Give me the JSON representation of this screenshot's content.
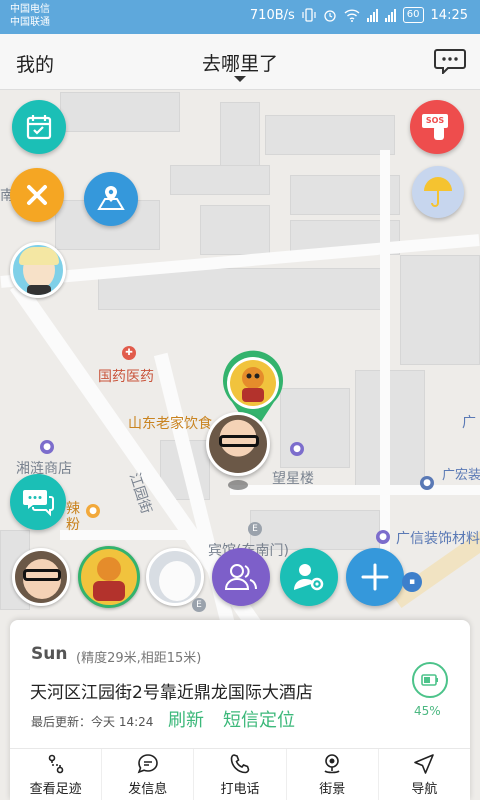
{
  "status_bar": {
    "carrier1": "中国电信",
    "carrier2": "中国联通",
    "speed": "710B/s",
    "battery": "60",
    "time": "14:25"
  },
  "header": {
    "left_label": "我的",
    "title": "去哪里了"
  },
  "map": {
    "pois": [
      {
        "text": "国药医药"
      },
      {
        "text": "山东老家饮食"
      },
      {
        "text": "湘涟商店"
      },
      {
        "text": "望星楼"
      },
      {
        "text": "广宏装饰材"
      },
      {
        "text": "广信装饰材料"
      },
      {
        "text": "江园街"
      },
      {
        "text": "辣"
      },
      {
        "text": "粉"
      },
      {
        "text": "宾馆(东南门)"
      },
      {
        "text": "南"
      },
      {
        "text": "广"
      }
    ]
  },
  "buttons": {
    "sos": "SOS"
  },
  "card": {
    "name": "Sun",
    "accuracy": "(精度29米,相距15米)",
    "address": "天河区江园街2号靠近鼎龙国际大酒店",
    "last_update": "最后更新：今天 14:24",
    "refresh": "刷新",
    "sms_locate": "短信定位",
    "battery_pct": "45%"
  },
  "bottom_bar": [
    {
      "label": "查看足迹",
      "icon": "footprint-icon"
    },
    {
      "label": "发信息",
      "icon": "message-icon"
    },
    {
      "label": "打电话",
      "icon": "phone-icon"
    },
    {
      "label": "街景",
      "icon": "street-view-icon"
    },
    {
      "label": "导航",
      "icon": "navigation-icon"
    }
  ],
  "colors": {
    "status_bar": "#5ea8dc",
    "teal": "#1bbfb6",
    "orange": "#f5a623",
    "blue": "#3598db",
    "red": "#ee4d4d",
    "purple": "#7d5fc9",
    "green": "#3cb87a"
  }
}
